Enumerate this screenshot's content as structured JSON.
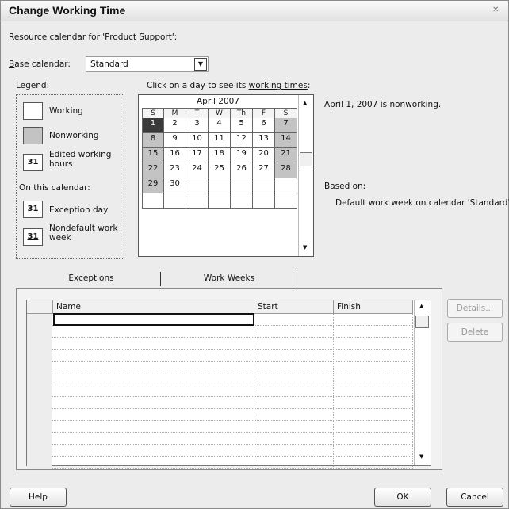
{
  "window": {
    "title": "Change Working Time",
    "close_glyph": "✕"
  },
  "resource_label": "Resource calendar for 'Product Support':",
  "base_calendar": {
    "label_first": "B",
    "label_rest": "ase calendar:",
    "value": "Standard"
  },
  "legend": {
    "title": "Legend:",
    "working": "Working",
    "nonworking": "Nonworking",
    "edited_day": "31",
    "edited_line1": "Edited working",
    "edited_line2": "hours",
    "on_this_calendar": "On this calendar:",
    "exception_day": "31",
    "exception": "Exception day",
    "nondefault_day": "31",
    "nondefault_line1": "Nondefault work",
    "nondefault_line2": "week"
  },
  "calendar": {
    "instruction_prefix": "Click on a day to see its ",
    "instruction_link": "working times",
    "instruction_suffix": ":",
    "month": "April 2007",
    "day_headers": [
      "S",
      "M",
      "T",
      "W",
      "Th",
      "F",
      "S"
    ],
    "weeks": [
      [
        "1",
        "2",
        "3",
        "4",
        "5",
        "6",
        "7"
      ],
      [
        "8",
        "9",
        "10",
        "11",
        "12",
        "13",
        "14"
      ],
      [
        "15",
        "16",
        "17",
        "18",
        "19",
        "20",
        "21"
      ],
      [
        "22",
        "23",
        "24",
        "25",
        "26",
        "27",
        "28"
      ],
      [
        "29",
        "30",
        "",
        "",
        "",
        "",
        ""
      ],
      [
        "",
        "",
        "",
        "",
        "",
        "",
        ""
      ]
    ],
    "selected": "1",
    "colors": {
      "nonworking": "#c3c3c3",
      "selected": "#3a3a3a",
      "working": "#ffffff"
    }
  },
  "status_text": "April 1, 2007 is nonworking.",
  "based_on": {
    "label": "Based on:",
    "text": "Default work week on calendar 'Standard'."
  },
  "tabs": [
    "Exceptions",
    "Work Weeks"
  ],
  "table": {
    "columns": [
      "Name",
      "Start",
      "Finish"
    ],
    "row_count": 13
  },
  "buttons": {
    "details_first": "D",
    "details_rest": "etails...",
    "delete": "Delete",
    "help": "Help",
    "ok": "OK",
    "cancel": "Cancel"
  },
  "icons": {
    "dropdown": "chevron-down-icon",
    "scroll_up": "scroll-up-icon",
    "scroll_down": "scroll-down-icon",
    "close": "close-icon"
  }
}
